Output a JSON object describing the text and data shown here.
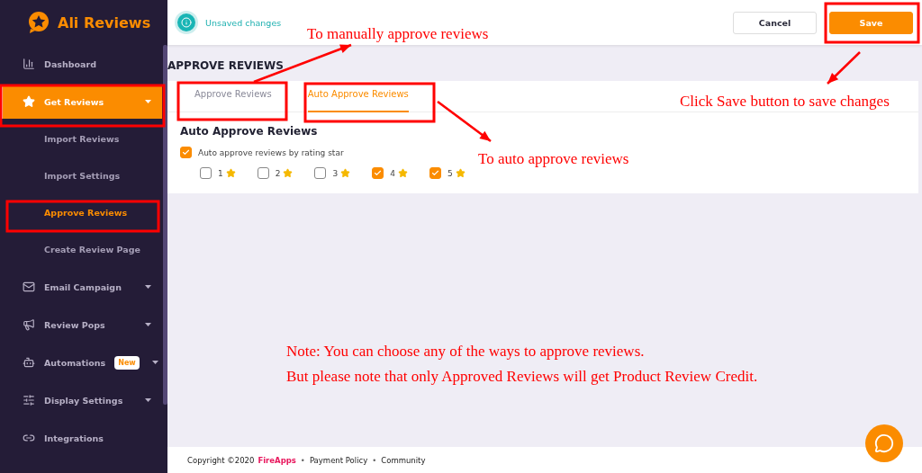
{
  "sidebar": {
    "logo": "Ali Reviews",
    "items": [
      {
        "label": "Dashboard",
        "selected": false,
        "has_caret": false
      },
      {
        "label": "Get Reviews",
        "selected": true,
        "has_caret": true,
        "children": [
          {
            "label": "Import Reviews",
            "selected": false
          },
          {
            "label": "Import Settings",
            "selected": false
          },
          {
            "label": "Approve Reviews",
            "selected": true
          },
          {
            "label": "Create Review Page",
            "selected": false
          }
        ]
      },
      {
        "label": "Email Campaign",
        "selected": false,
        "has_caret": true
      },
      {
        "label": "Review Pops",
        "selected": false,
        "has_caret": true
      },
      {
        "label": "Automations",
        "selected": false,
        "has_caret": true,
        "badge": "New"
      },
      {
        "label": "Display Settings",
        "selected": false,
        "has_caret": true
      },
      {
        "label": "Integrations",
        "selected": false,
        "has_caret": false
      }
    ]
  },
  "topbar": {
    "status": "Unsaved changes",
    "buttons": [
      {
        "label": "Cancel",
        "kind": "secondary"
      },
      {
        "label": "Save",
        "kind": "primary"
      }
    ]
  },
  "page_title": "APPROVE REVIEWS",
  "tabs": [
    {
      "label": "Approve Reviews",
      "selected": false
    },
    {
      "label": "Auto Approve Reviews",
      "selected": true
    }
  ],
  "section": {
    "title": "Auto Approve Reviews",
    "toggle": {
      "label": "Auto approve reviews by rating star",
      "checked": true
    },
    "ratings": [
      {
        "label": "1",
        "checked": false
      },
      {
        "label": "2",
        "checked": false
      },
      {
        "label": "3",
        "checked": false
      },
      {
        "label": "4",
        "checked": true
      },
      {
        "label": "5",
        "checked": true
      }
    ]
  },
  "footer": {
    "copyright": "Copyright ©2020",
    "brand": "FireApps",
    "links": [
      {
        "kind": "separator",
        "text": "•"
      },
      {
        "kind": "link",
        "text": "Payment Policy"
      },
      {
        "kind": "separator",
        "text": "•"
      },
      {
        "kind": "link",
        "text": "Community"
      }
    ]
  },
  "annotations": {
    "manual": "To manually approve reviews",
    "save": "Click Save button to save changes",
    "auto": "To auto approve reviews",
    "note": [
      "Note: You can choose any of the ways to approve reviews.",
      "But please note that only Approved Reviews will get Product Review Credit."
    ]
  }
}
